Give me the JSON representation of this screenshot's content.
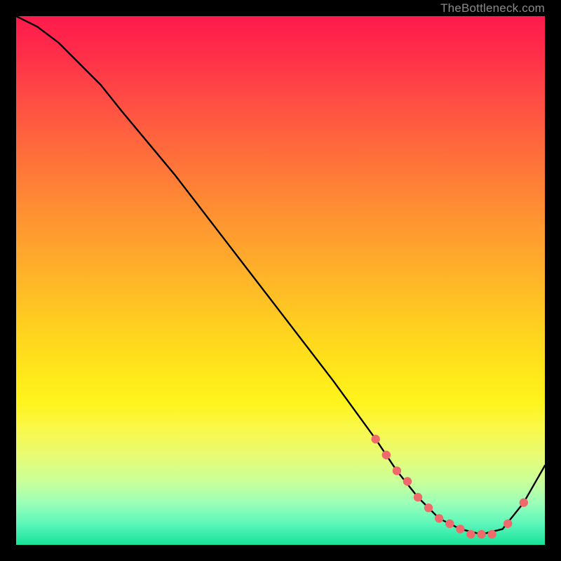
{
  "watermark": "TheBottleneck.com",
  "colors": {
    "curve": "#000000",
    "dot_fill": "#ef6b6b",
    "dot_stroke": "#ef6b6b",
    "panel_bg_top": "#ff1a4d",
    "panel_bg_bottom": "#18e29a",
    "page_bg": "#000000"
  },
  "chart_data": {
    "type": "line",
    "title": "",
    "xlabel": "",
    "ylabel": "",
    "xlim": [
      0,
      100
    ],
    "ylim": [
      0,
      100
    ],
    "grid": false,
    "legend": false,
    "series": [
      {
        "name": "curve",
        "x": [
          0,
          4,
          8,
          12,
          16,
          20,
          30,
          40,
          50,
          60,
          68,
          72,
          76,
          80,
          84,
          88,
          92,
          96,
          100
        ],
        "y": [
          100,
          98,
          95,
          91,
          87,
          82,
          70,
          57,
          44,
          31,
          20,
          14,
          9,
          5,
          3,
          2,
          3,
          8,
          15
        ]
      }
    ],
    "dots": {
      "name": "highlight-dots",
      "x": [
        68,
        70,
        72,
        74,
        76,
        78,
        80,
        82,
        84,
        86,
        88,
        90,
        93,
        96
      ],
      "y": [
        20,
        17,
        14,
        12,
        9,
        7,
        5,
        4,
        3,
        2,
        2,
        2,
        4,
        8
      ]
    }
  }
}
